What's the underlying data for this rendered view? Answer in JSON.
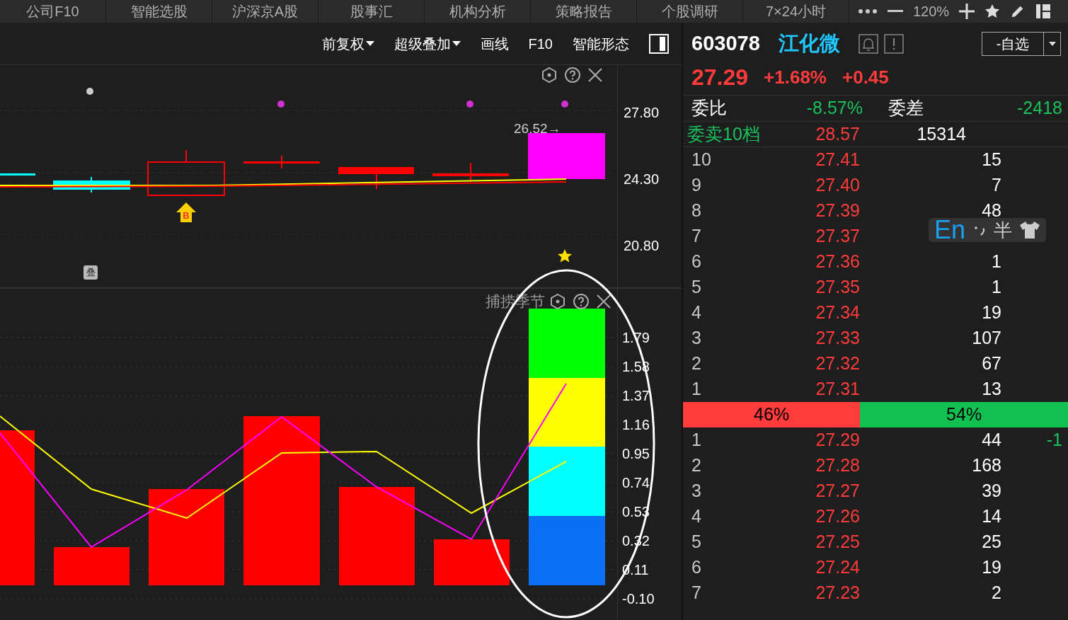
{
  "top_tabs": [
    {
      "label": "公司F10",
      "selected": false
    },
    {
      "label": "智能选股",
      "selected": false
    },
    {
      "label": "沪深京A股",
      "selected": false
    },
    {
      "label": "股事汇",
      "selected": false
    },
    {
      "label": "机构分析",
      "selected": false
    },
    {
      "label": "策略报告",
      "selected": false
    },
    {
      "label": "个股调研",
      "selected": false
    },
    {
      "label": "7×24小时",
      "selected": false
    }
  ],
  "zoom": "120%",
  "chart_toolbar": [
    {
      "label": "前复权",
      "dropdown": true
    },
    {
      "label": "超级叠加",
      "dropdown": true
    },
    {
      "label": "画线",
      "dropdown": false
    },
    {
      "label": "F10",
      "dropdown": false
    },
    {
      "label": "智能形态",
      "dropdown": false
    }
  ],
  "main_chart": {
    "price_tag": "26.52→",
    "badge": "叠",
    "buy_marker": "B",
    "y_ticks": [
      "27.80",
      "24.30",
      "20.80"
    ]
  },
  "indicator": {
    "title": "捕捞季节",
    "y_ticks": [
      "1.79",
      "1.58",
      "1.37",
      "1.16",
      "0.95",
      "0.74",
      "0.53",
      "0.32",
      "0.11",
      "-0.10"
    ]
  },
  "quote": {
    "code": "603078",
    "name": "江化微",
    "watch_button": "-自选",
    "price": "27.29",
    "change_pct": "+1.68%",
    "change": "+0.45"
  },
  "stats": {
    "ratio_label": "委比",
    "ratio": "-8.57%",
    "diff_label": "委差",
    "diff": "-2418"
  },
  "ask_total": {
    "label": "委卖10档",
    "price": "28.57",
    "volume": "15314"
  },
  "asks": [
    {
      "level": "10",
      "price": "27.41",
      "volume": "15"
    },
    {
      "level": "9",
      "price": "27.40",
      "volume": "7"
    },
    {
      "level": "8",
      "price": "27.39",
      "volume": "48"
    },
    {
      "level": "7",
      "price": "27.37"
    },
    {
      "level": "6",
      "price": "27.36",
      "volume": "1"
    },
    {
      "level": "5",
      "price": "27.35",
      "volume": "1"
    },
    {
      "level": "4",
      "price": "27.34",
      "volume": "19"
    },
    {
      "level": "3",
      "price": "27.33",
      "volume": "107"
    },
    {
      "level": "2",
      "price": "27.32",
      "volume": "67"
    },
    {
      "level": "1",
      "price": "27.31",
      "volume": "13"
    }
  ],
  "balance": {
    "level": 0.46,
    "buy": "46%",
    "sell": "54%"
  },
  "bids": [
    {
      "level": "1",
      "price": "27.29",
      "volume": "44",
      "change": "-1"
    },
    {
      "level": "2",
      "price": "27.28",
      "volume": "168"
    },
    {
      "level": "3",
      "price": "27.27",
      "volume": "39"
    },
    {
      "level": "4",
      "price": "27.26",
      "volume": "14"
    },
    {
      "level": "5",
      "price": "27.25",
      "volume": "25"
    },
    {
      "level": "6",
      "price": "27.24",
      "volume": "19"
    },
    {
      "level": "7",
      "price": "27.23",
      "volume": "2"
    }
  ],
  "ime_bar": {
    "mode": "En",
    "width": "半"
  }
}
